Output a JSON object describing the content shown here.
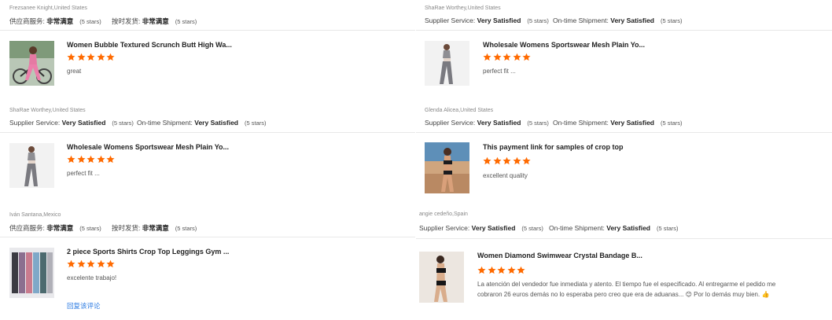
{
  "colors": {
    "star": "#ff6a00",
    "link": "#2a7ae2",
    "divider": "#e8e8e8"
  },
  "left_column": [
    {
      "buyer": "Frezsanee Knight,United States",
      "supplier_label": "供应商服务:",
      "supplier_value": "非常满意",
      "supplier_stars": "(5 stars)",
      "shipment_label": "按时发货:",
      "shipment_value": "非常满意",
      "shipment_stars": "(5 stars)",
      "product_title": "Women Bubble Textured Scrunch Butt High Wa...",
      "rating": 5,
      "comment": "great",
      "thumb_icon": "pink-leggings-photo"
    },
    {
      "buyer": "ShaRae Worthey,United States",
      "supplier_label": "Supplier Service:",
      "supplier_value": "Very Satisfied",
      "supplier_stars": "(5 stars)",
      "shipment_label": "On-time Shipment:",
      "shipment_value": "Very Satisfied",
      "shipment_stars": "(5 stars)",
      "product_title": "Wholesale Womens Sportswear Mesh Plain Yo...",
      "rating": 5,
      "comment": "perfect fit ...",
      "thumb_icon": "grey-sportswear-photo"
    },
    {
      "buyer": "Iván Santana,Mexico",
      "supplier_label": "供应商服务:",
      "supplier_value": "非常满意",
      "supplier_stars": "(5 stars)",
      "shipment_label": "按时发货:",
      "shipment_value": "非常满意",
      "shipment_stars": "(5 stars)",
      "product_title": "2 piece Sports Shirts Crop Top Leggings Gym ...",
      "rating": 5,
      "comment": "excelente trabajo!",
      "reply_link": "回复该评论",
      "thumb_icon": "sports-sets-photo"
    }
  ],
  "right_column": [
    {
      "buyer": "ShaRae Worthey,United States",
      "supplier_label": "Supplier Service:",
      "supplier_value": "Very Satisfied",
      "supplier_stars": "(5 stars)",
      "shipment_label": "On-time Shipment:",
      "shipment_value": "Very Satisfied",
      "shipment_stars": "(5 stars)",
      "product_title": "Wholesale Womens Sportswear Mesh Plain Yo...",
      "rating": 5,
      "comment": "perfect fit ...",
      "thumb_icon": "grey-sportswear-photo"
    },
    {
      "buyer": "Glenda Alicea,United States",
      "supplier_label": "Supplier Service:",
      "supplier_value": "Very Satisfied",
      "supplier_stars": "(5 stars)",
      "shipment_label": "On-time Shipment:",
      "shipment_value": "Very Satisfied",
      "shipment_stars": "(5 stars)",
      "product_title": "This payment link for samples of crop top",
      "rating": 5,
      "comment": "excellent quality",
      "thumb_icon": "bikini-photo"
    },
    {
      "buyer": "angie cedeño,Spain",
      "supplier_label": "Supplier Service:",
      "supplier_value": "Very Satisfied",
      "supplier_stars": "(5 stars)",
      "shipment_label": "On-time Shipment:",
      "shipment_value": "Very Satisfied",
      "shipment_stars": "(5 stars)",
      "product_title": "Women Diamond Swimwear Crystal Bandage B...",
      "rating": 5,
      "comment_line1": "La atención del vendedor fue inmediata y atento. El tiempo fue el especificado. Al entregarme el pedido me",
      "comment_line2": "cobraron 26 euros demás no lo esperaba pero creo que era de aduanas... 😊 Por lo demás muy bien. 👍",
      "thumb_icon": "black-swimwear-photo"
    }
  ]
}
